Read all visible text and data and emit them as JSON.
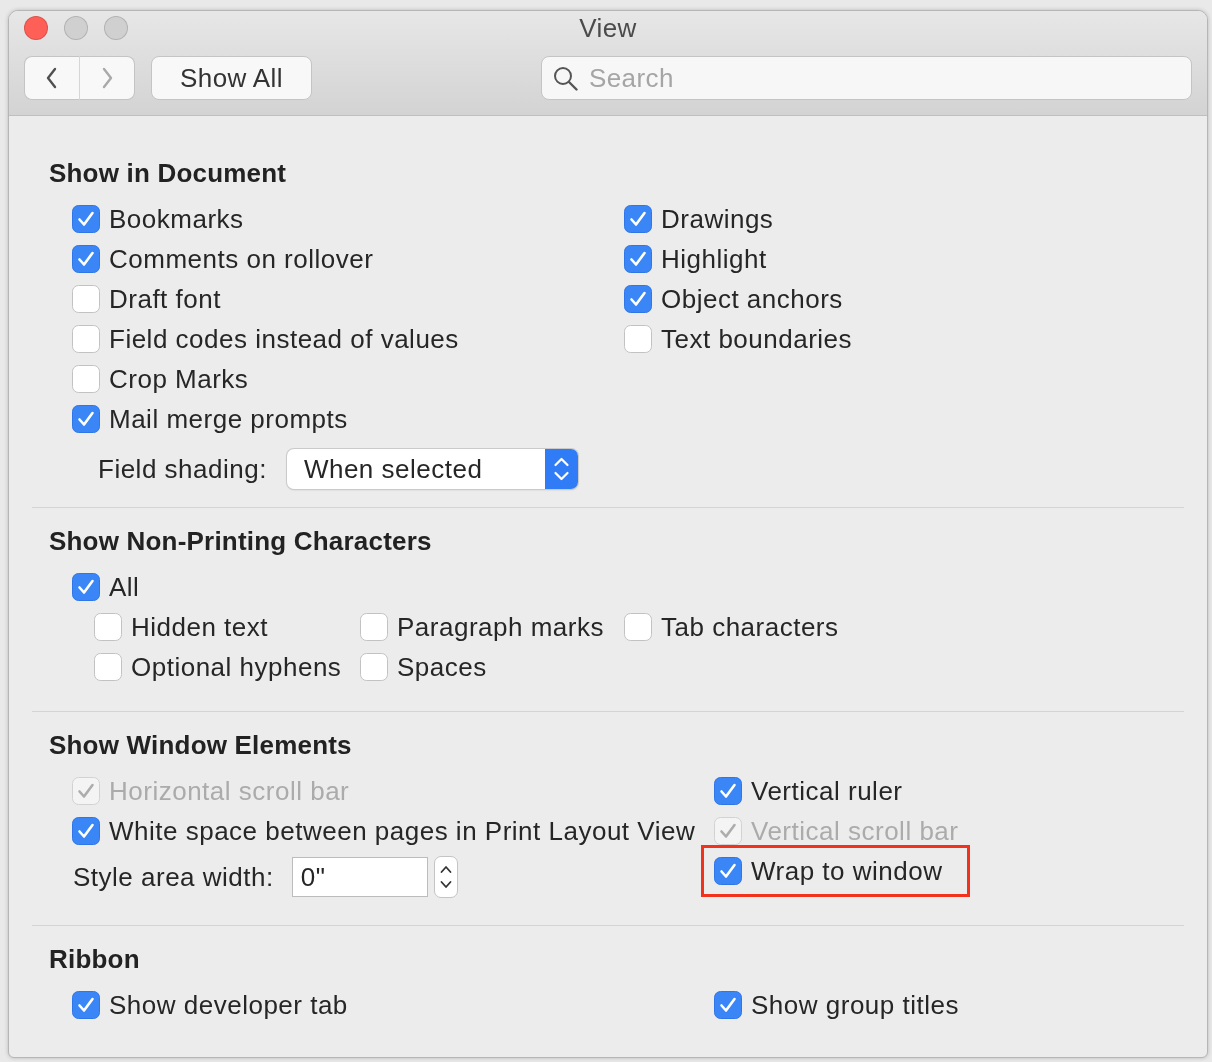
{
  "window": {
    "title": "View",
    "buttons": [
      {
        "kind": "close",
        "disabled": false
      },
      {
        "kind": "minimize",
        "disabled": true
      },
      {
        "kind": "zoom",
        "disabled": true
      }
    ]
  },
  "toolbar": {
    "nav": [
      {
        "kind": "back",
        "disabled": false
      },
      {
        "kind": "forward",
        "disabled": true
      }
    ],
    "show_all": "Show All",
    "search": {
      "placeholder": "Search"
    }
  },
  "show_in_document": {
    "title": "Show in Document",
    "left": [
      {
        "label": "Bookmarks",
        "checked": true
      },
      {
        "label": "Comments on rollover",
        "checked": true
      },
      {
        "label": "Draft font",
        "checked": false
      },
      {
        "label": "Field codes instead of values",
        "checked": false
      },
      {
        "label": "Crop Marks",
        "checked": false
      },
      {
        "label": "Mail merge prompts",
        "checked": true
      }
    ],
    "right": [
      {
        "label": "Drawings",
        "checked": true
      },
      {
        "label": "Highlight",
        "checked": true
      },
      {
        "label": "Object anchors",
        "checked": true
      },
      {
        "label": "Text boundaries",
        "checked": false
      }
    ],
    "field_shading": {
      "label": "Field shading:",
      "value": "When selected"
    }
  },
  "non_printing": {
    "title": "Show Non-Printing Characters",
    "all": {
      "label": "All",
      "checked": true
    },
    "columns": [
      [
        {
          "label": "Hidden text",
          "checked": false
        },
        {
          "label": "Optional hyphens",
          "checked": false
        }
      ],
      [
        {
          "label": "Paragraph marks",
          "checked": false
        },
        {
          "label": "Spaces",
          "checked": false
        }
      ],
      [
        {
          "label": "Tab characters",
          "checked": false
        }
      ]
    ]
  },
  "window_elements": {
    "title": "Show Window Elements",
    "left": [
      {
        "label": "Horizontal scroll bar",
        "checked": true,
        "disabled": true
      },
      {
        "label": "White space between pages in Print Layout View",
        "checked": true,
        "disabled": false
      }
    ],
    "style_area": {
      "label": "Style area width:",
      "value": "0\""
    },
    "right": [
      {
        "label": "Vertical ruler",
        "checked": true,
        "disabled": false,
        "highlighted": false
      },
      {
        "label": "Vertical scroll bar",
        "checked": true,
        "disabled": true,
        "highlighted": false
      },
      {
        "label": "Wrap to window",
        "checked": true,
        "disabled": false,
        "highlighted": true
      }
    ]
  },
  "ribbon": {
    "title": "Ribbon",
    "left": [
      {
        "label": "Show developer tab",
        "checked": true
      }
    ],
    "right": [
      {
        "label": "Show group titles",
        "checked": true
      }
    ]
  }
}
